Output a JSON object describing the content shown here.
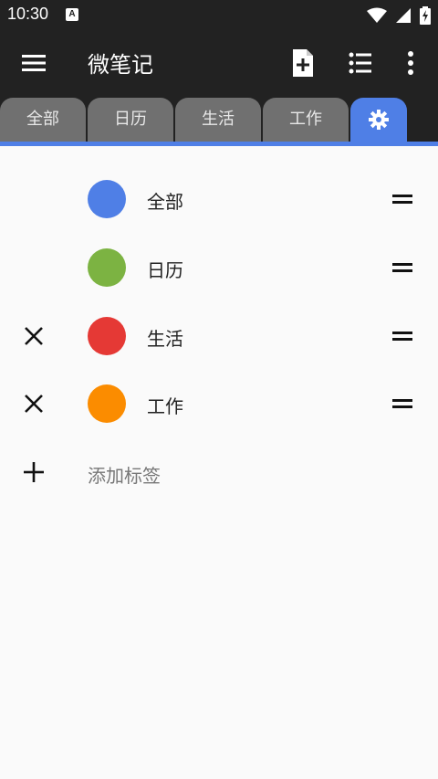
{
  "status_bar": {
    "time": "10:30",
    "notification_icon": "A",
    "icons": [
      "wifi-icon",
      "signal-icon",
      "battery-icon"
    ]
  },
  "app_bar": {
    "title": "微笔记",
    "actions": [
      "new-note-icon",
      "list-view-icon",
      "more-icon"
    ]
  },
  "tabs": [
    {
      "label": "全部",
      "active": false
    },
    {
      "label": "日历",
      "active": false
    },
    {
      "label": "生活",
      "active": false
    },
    {
      "label": "工作",
      "active": false
    },
    {
      "label": "",
      "icon": "gear-icon",
      "active": true
    }
  ],
  "tags": [
    {
      "label": "全部",
      "color": "#4f7fe6",
      "deletable": false
    },
    {
      "label": "日历",
      "color": "#7cb342",
      "deletable": false
    },
    {
      "label": "生活",
      "color": "#e53935",
      "deletable": true
    },
    {
      "label": "工作",
      "color": "#fb8c00",
      "deletable": true
    }
  ],
  "add_tag_label": "添加标签",
  "colors": {
    "accent": "#4f7fe6",
    "bar_background": "#222222",
    "tab_inactive": "#707070",
    "page_background": "#fafafa"
  }
}
